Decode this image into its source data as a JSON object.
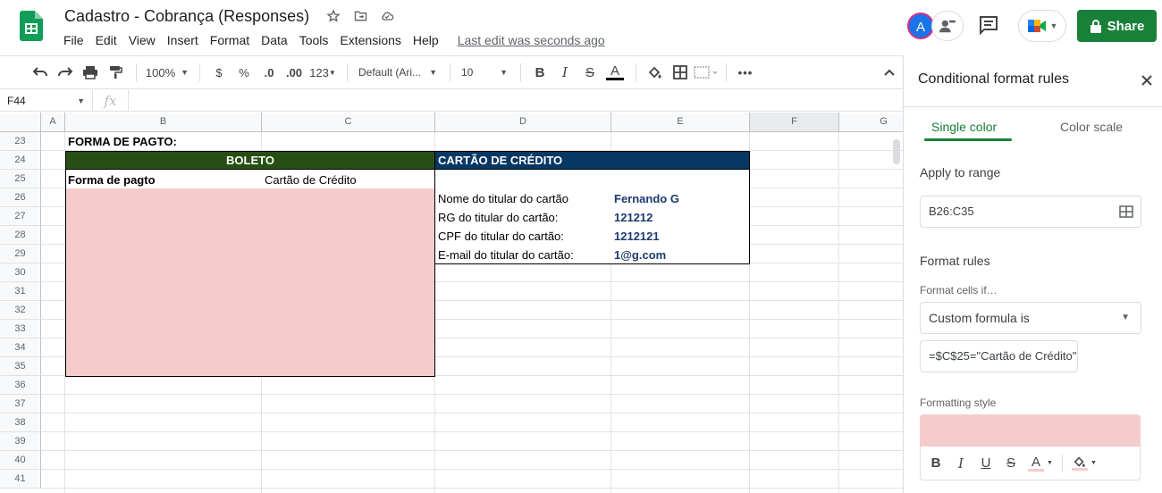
{
  "header": {
    "doc_title": "Cadastro - Cobrança (Responses)",
    "menu": [
      "File",
      "Edit",
      "View",
      "Insert",
      "Format",
      "Data",
      "Tools",
      "Extensions",
      "Help"
    ],
    "last_edit": "Last edit was seconds ago",
    "avatar_initial": "A",
    "share_label": "Share"
  },
  "toolbar": {
    "zoom": "100%",
    "currency": "$",
    "percent": "%",
    "dec_decrease": ".0",
    "dec_increase": ".00",
    "more_formats": "123",
    "font": "Default (Ari...",
    "font_size": "10",
    "bold": "B",
    "italic": "I",
    "strike": "S",
    "text_color": "A"
  },
  "formula_bar": {
    "cell_ref": "F44",
    "fx": "fx",
    "content": ""
  },
  "grid": {
    "columns": [
      "A",
      "B",
      "C",
      "D",
      "E",
      "F",
      "G"
    ],
    "rows": [
      "23",
      "24",
      "25",
      "26",
      "27",
      "28",
      "29",
      "30",
      "31",
      "32",
      "33",
      "34",
      "35",
      "36",
      "37",
      "38",
      "39",
      "40",
      "41"
    ],
    "selected_column": "F",
    "cells": {
      "b23": "FORMA DE PAGTO:",
      "boleto_header": "BOLETO",
      "cartao_header": "CARTÃO DE CRÉDITO",
      "b25": "Forma de pagto",
      "c25": "Cartão de Crédito",
      "d26": "Nome do titular do cartão",
      "e26": "Fernando G",
      "d27": "RG do titular do cartão:",
      "e27": "121212",
      "d28": "CPF do titular do cartão:",
      "e28": "1212121",
      "d29": "E-mail do titular do cartão:",
      "e29": "1@g.com"
    },
    "colors": {
      "boleto_header_bg": "#274e13",
      "cartao_header_bg": "#073763",
      "highlight_bg": "#f4cccc",
      "value_text": "#1c3a6e"
    }
  },
  "panel": {
    "title": "Conditional format rules",
    "tab_single": "Single color",
    "tab_scale": "Color scale",
    "apply_label": "Apply to range",
    "range_value": "B26:C35",
    "format_rules_label": "Format rules",
    "format_cells_if": "Format cells if…",
    "condition": "Custom formula is",
    "formula_value": "=$C$25=\"Cartão de Crédito\"",
    "formatting_style": "Formatting style",
    "style_bold": "B",
    "style_italic": "I",
    "style_underline": "U",
    "style_strike": "S",
    "style_color": "A"
  }
}
